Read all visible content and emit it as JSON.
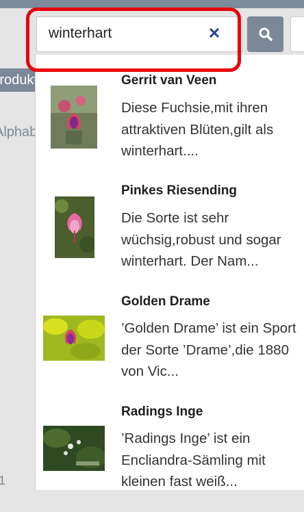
{
  "search": {
    "value": "winterhart",
    "clear_icon": "close-icon",
    "button_icon": "search-icon",
    "accent_color": "#e8000b"
  },
  "sidebar": {
    "tab_label": "Produkte",
    "item_label": "Alphabetisch",
    "footer_number": "1"
  },
  "results": [
    {
      "title": "Gerrit van Veen",
      "description": "Diese Fuchsie,mit ihren attraktiven Blüten,gilt als winterhart...."
    },
    {
      "title": "Pinkes Riesending",
      "description": "Die Sorte ist sehr wüchsig,robust und sogar winterhart. Der Nam..."
    },
    {
      "title": "Golden Drame",
      "description": "’Golden Drame’ ist ein Sport der Sorte ’Drame’,die 1880 von Vic..."
    },
    {
      "title": "Radings Inge",
      "description": "’Radings Inge’ ist ein Encliandra-Sämling mit kleinen fast weiß..."
    }
  ]
}
